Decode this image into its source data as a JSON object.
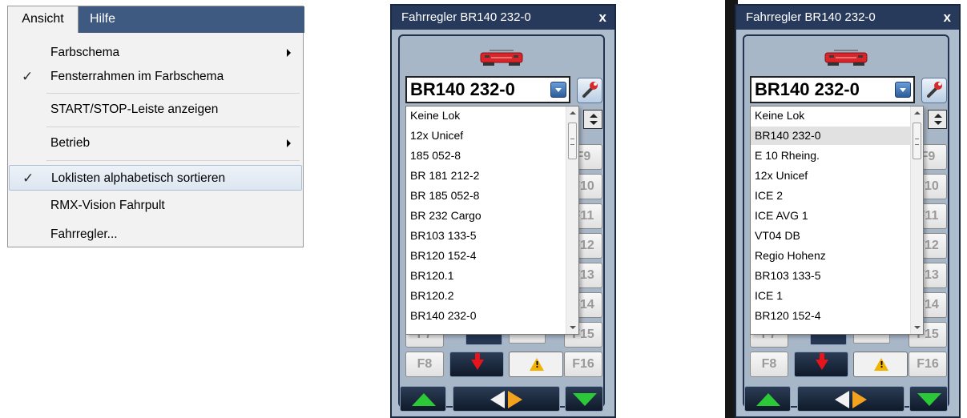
{
  "menu": {
    "tabs": [
      {
        "label": "Ansicht",
        "active": true
      },
      {
        "label": "Hilfe",
        "active": false
      }
    ],
    "items": [
      {
        "label": "Farbschema",
        "checked": false,
        "submenu": true,
        "highlighted": false
      },
      {
        "label": "Fensterrahmen im Farbschema",
        "checked": true,
        "submenu": false,
        "highlighted": false
      },
      {
        "label": "START/STOP-Leiste anzeigen",
        "checked": false,
        "submenu": false,
        "highlighted": false
      },
      {
        "label": "Betrieb",
        "checked": false,
        "submenu": true,
        "highlighted": false
      },
      {
        "label": "Loklisten alphabetisch sortieren",
        "checked": true,
        "submenu": false,
        "highlighted": true
      },
      {
        "label": "RMX-Vision Fahrpult",
        "checked": false,
        "submenu": false,
        "highlighted": false
      },
      {
        "label": "Fahrregler...",
        "checked": false,
        "submenu": false,
        "highlighted": false
      }
    ]
  },
  "panels": [
    {
      "title": "Fahrregler BR140 232-0",
      "close": "x",
      "selected_loco": "BR140 232-0",
      "list": [
        "Keine Lok",
        "12x Unicef",
        "185 052-8",
        "BR 181 212-2",
        "BR 185 052-8",
        "BR 232 Cargo",
        "BR103 133-5",
        "BR120 152-4",
        "BR120.1",
        "BR120.2",
        "BR140 232-0"
      ],
      "highlighted_index": -1,
      "fkeys_right": [
        "F9",
        "F10",
        "F11",
        "F12",
        "F13",
        "F14",
        "F15",
        "F16"
      ],
      "fkey_left_partial": "F7",
      "fkey_left": "F8"
    },
    {
      "title": "Fahrregler BR140 232-0",
      "close": "x",
      "selected_loco": "BR140 232-0",
      "list": [
        "Keine Lok",
        "BR140 232-0",
        "E 10 Rheing.",
        "12x Unicef",
        "ICE 2",
        "ICE AVG 1",
        "VT04 DB",
        "Regio Hohenz",
        "BR103 133-5",
        "ICE 1",
        "BR120 152-4"
      ],
      "highlighted_index": 1,
      "fkeys_right": [
        "F9",
        "F10",
        "F11",
        "F12",
        "F13",
        "F14",
        "F15",
        "F16"
      ],
      "fkey_left_partial": "F7",
      "fkey_left": "F8"
    }
  ],
  "icons": {
    "check": "✓",
    "loco": "locomotive-icon",
    "wrench": "wrench-icon"
  },
  "colors": {
    "menubar": "#3e5a80",
    "title_bar": "#273a5c",
    "panel_bg": "#aebdcd",
    "highlight": "#dde6f1",
    "loco_red": "#d9242a",
    "forward_green": "#2bc837",
    "direction_orange": "#f2a21c"
  }
}
